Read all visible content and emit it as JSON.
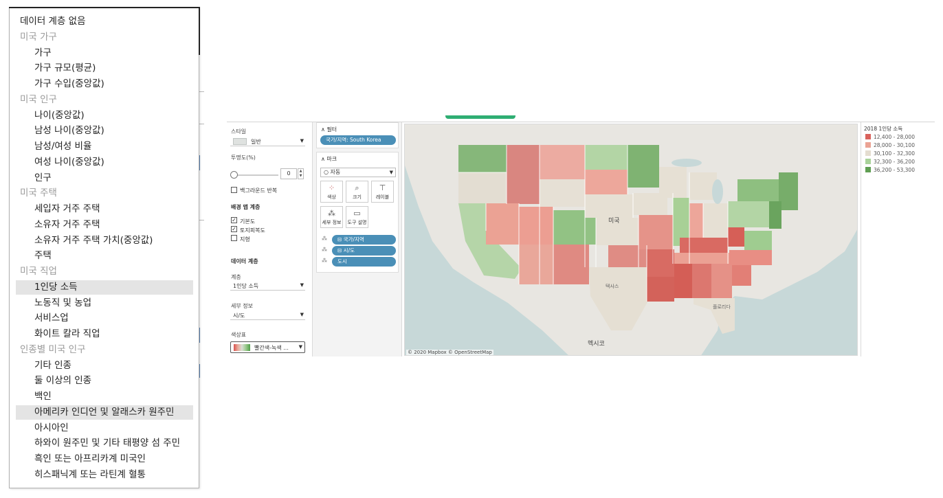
{
  "dropdown": {
    "items": [
      {
        "label": "데이터 계층 없음",
        "type": "option"
      },
      {
        "label": "미국 가구",
        "type": "group"
      },
      {
        "label": "가구",
        "type": "sub"
      },
      {
        "label": "가구 규모(평균)",
        "type": "sub"
      },
      {
        "label": "가구 수입(중앙값)",
        "type": "sub"
      },
      {
        "label": "미국 인구",
        "type": "group"
      },
      {
        "label": "나이(중앙값)",
        "type": "sub"
      },
      {
        "label": "남성 나이(중앙값)",
        "type": "sub"
      },
      {
        "label": "남성/여성 비율",
        "type": "sub"
      },
      {
        "label": "여성 나이(중앙값)",
        "type": "sub"
      },
      {
        "label": "인구",
        "type": "sub"
      },
      {
        "label": "미국 주택",
        "type": "group"
      },
      {
        "label": "세입자 거주 주택",
        "type": "sub"
      },
      {
        "label": "소유자 거주 주택",
        "type": "sub"
      },
      {
        "label": "소유자 거주 주택 가치(중앙값)",
        "type": "sub"
      },
      {
        "label": "주택",
        "type": "sub"
      },
      {
        "label": "미국 직업",
        "type": "group"
      },
      {
        "label": "1인당 소득",
        "type": "sub",
        "highlighted": true
      },
      {
        "label": "노동직 및 농업",
        "type": "sub"
      },
      {
        "label": "서비스업",
        "type": "sub"
      },
      {
        "label": "화이트 칼라 직업",
        "type": "sub"
      },
      {
        "label": "인종별 미국 인구",
        "type": "group"
      },
      {
        "label": "기타 인종",
        "type": "sub"
      },
      {
        "label": "둘 이상의 인종",
        "type": "sub"
      },
      {
        "label": "백인",
        "type": "sub"
      },
      {
        "label": "아메리카 인디언 및 알래스카 원주민",
        "type": "sub",
        "highlighted": true
      },
      {
        "label": "아시아인",
        "type": "sub"
      },
      {
        "label": "하와이 원주민 및 기타 태평양 섬 주민",
        "type": "sub"
      },
      {
        "label": "흑인 또는 아프리카계 미국인",
        "type": "sub"
      },
      {
        "label": "히스패닉계 또는 라틴계 혈통",
        "type": "sub"
      }
    ]
  },
  "left_pane": {
    "style_label": "스타일",
    "style_value": "일반",
    "opacity_label": "투명도(%)",
    "opacity_value": "0",
    "repeat_bg_label": "백그라운드 반복",
    "bg_layers_label": "배경 맵 계층",
    "layer_base": "기본도",
    "layer_landcover": "토지피복도",
    "layer_terrain": "지형",
    "data_layer_label": "데이터 계층",
    "layer_label": "계층",
    "layer_value": "1인당 소득",
    "detail_label": "세부 정보",
    "detail_value": "시/도",
    "palette_label": "색상표",
    "palette_value": "빨간색-녹색 ..."
  },
  "mid_pane": {
    "filter_title": "∧ 필터",
    "filter_pill": "국가/지역: South Korea",
    "marks_title": "∧ 마크",
    "marks_type": "○ 자동",
    "btn_color": "색상",
    "btn_size": "크기",
    "btn_label": "레이블",
    "btn_detail": "세부 정보",
    "btn_tooltip": "도구 설명",
    "pill_country": "⊟ 국가/지역",
    "pill_state": "⊟ 시/도",
    "pill_city": "도시"
  },
  "map": {
    "attribution": "© 2020 Mapbox © OpenStreetMap",
    "label_usa": "미국",
    "label_mexico": "멕시코",
    "label_texas": "텍사스",
    "label_florida": "플로리다"
  },
  "legend": {
    "title": "2018 1인당 소득",
    "items": [
      {
        "label": "12,400 - 28,000",
        "color": "#d9625c"
      },
      {
        "label": "28,000 - 30,100",
        "color": "#eba394"
      },
      {
        "label": "30,100 - 32,300",
        "color": "#e4ddd0"
      },
      {
        "label": "32,300 - 36,200",
        "color": "#a9d29a"
      },
      {
        "label": "36,200 - 53,300",
        "color": "#5f9e52"
      }
    ]
  }
}
